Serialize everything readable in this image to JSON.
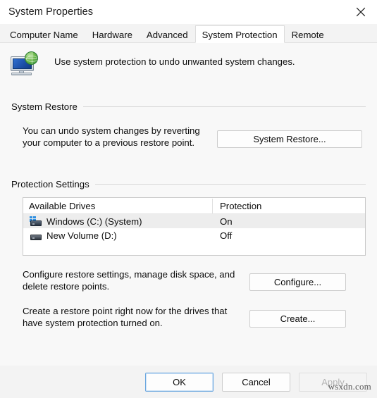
{
  "window": {
    "title": "System Properties",
    "close_icon": "close-icon"
  },
  "tabs": [
    {
      "label": "Computer Name",
      "active": false
    },
    {
      "label": "Hardware",
      "active": false
    },
    {
      "label": "Advanced",
      "active": false
    },
    {
      "label": "System Protection",
      "active": true
    },
    {
      "label": "Remote",
      "active": false
    }
  ],
  "intro": {
    "icon": "system-protection-icon",
    "text": "Use system protection to undo unwanted system changes."
  },
  "system_restore": {
    "group_title": "System Restore",
    "description": "You can undo system changes by reverting your computer to a previous restore point.",
    "button_label": "System Restore..."
  },
  "protection_settings": {
    "group_title": "Protection Settings",
    "columns": [
      "Available Drives",
      "Protection"
    ],
    "rows": [
      {
        "icon": "windows-system-drive-icon",
        "drive": "Windows (C:) (System)",
        "protection": "On",
        "selected": true
      },
      {
        "icon": "drive-icon",
        "drive": "New Volume (D:)",
        "protection": "Off",
        "selected": false
      }
    ],
    "configure": {
      "description": "Configure restore settings, manage disk space, and delete restore points.",
      "button_label": "Configure..."
    },
    "create": {
      "description": "Create a restore point right now for the drives that have system protection turned on.",
      "button_label": "Create..."
    }
  },
  "footer": {
    "ok_label": "OK",
    "cancel_label": "Cancel",
    "apply_label": "Apply",
    "apply_disabled": true
  },
  "watermark": "wsxdn.com",
  "colors": {
    "dialog_background": "#f3f3f3",
    "page_background": "#f8f8f8",
    "accent_focus": "#6aa6df",
    "selected_row": "#ededed",
    "text": "#0c0c0c",
    "disabled_text": "#b4b4b4"
  }
}
